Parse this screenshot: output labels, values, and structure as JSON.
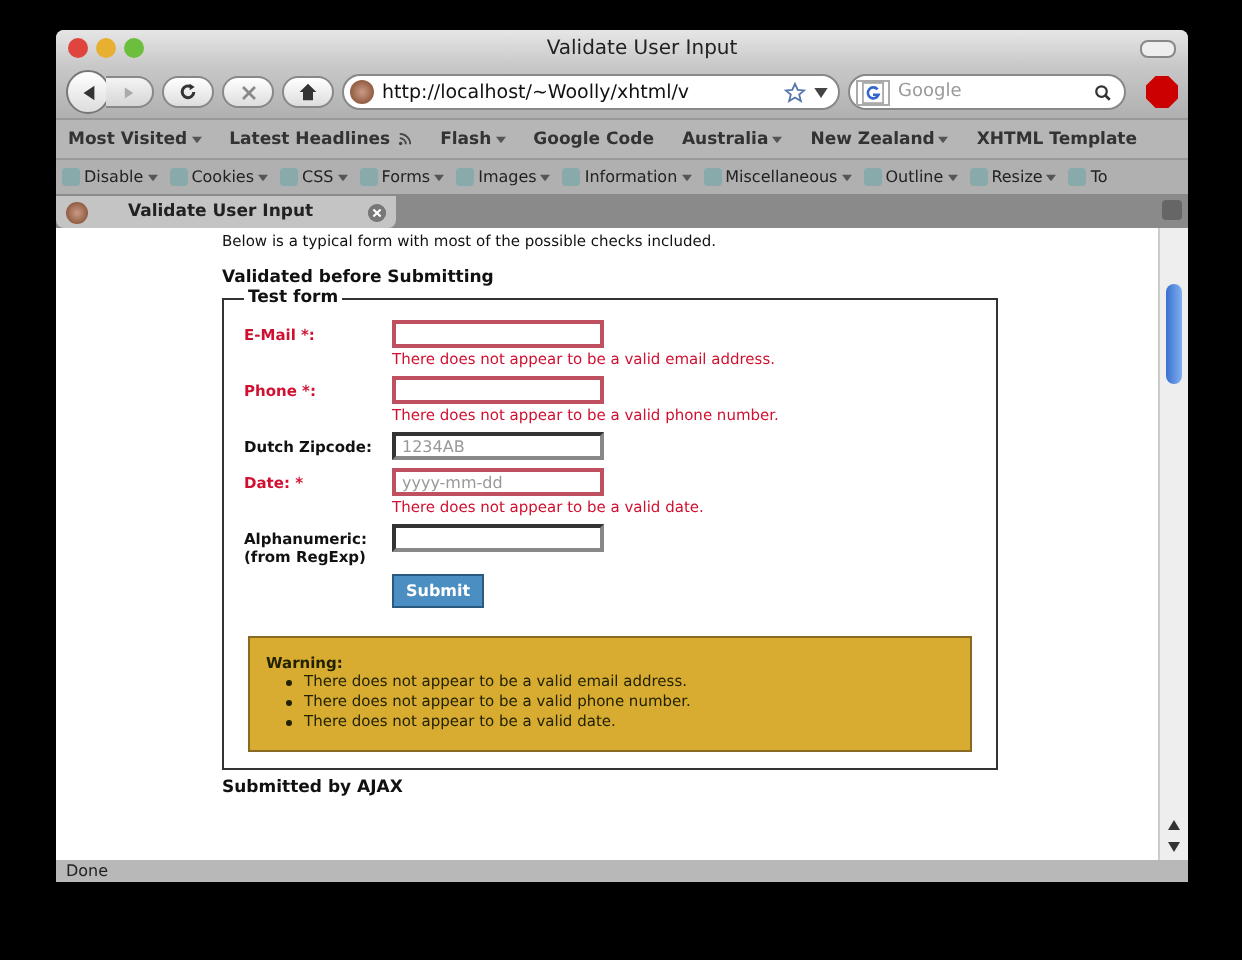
{
  "window": {
    "title": "Validate User Input"
  },
  "nav": {
    "url": "http://localhost/~Woolly/xhtml/v",
    "search_placeholder": "Google"
  },
  "bookmarks": [
    {
      "label": "Most Visited",
      "kind": "menu"
    },
    {
      "label": "Latest Headlines",
      "kind": "feed"
    },
    {
      "label": "Flash",
      "kind": "menu"
    },
    {
      "label": "Google Code",
      "kind": "link"
    },
    {
      "label": "Australia",
      "kind": "menu"
    },
    {
      "label": "New Zealand",
      "kind": "menu"
    },
    {
      "label": "XHTML Template",
      "kind": "link"
    }
  ],
  "dev_toolbar": [
    {
      "label": "Disable",
      "kind": "menu"
    },
    {
      "label": "Cookies",
      "kind": "menu"
    },
    {
      "label": "CSS",
      "kind": "menu"
    },
    {
      "label": "Forms",
      "kind": "menu"
    },
    {
      "label": "Images",
      "kind": "menu"
    },
    {
      "label": "Information",
      "kind": "menu"
    },
    {
      "label": "Miscellaneous",
      "kind": "menu"
    },
    {
      "label": "Outline",
      "kind": "menu"
    },
    {
      "label": "Resize",
      "kind": "menu"
    },
    {
      "label": "To",
      "kind": "link"
    }
  ],
  "tabs": [
    {
      "label": "Validate User Input",
      "selected": true
    }
  ],
  "page": {
    "intro": "Below is a typical form with most of the possible checks included.",
    "heading": "Validated before Submitting",
    "legend": "Test form",
    "fields": [
      {
        "label": "E-Mail *:",
        "invalid": true,
        "error": "There does not appear to be a valid email address."
      },
      {
        "label": "Phone *:",
        "invalid": true,
        "error": "There does not appear to be a valid phone number."
      },
      {
        "label": "Dutch Zipcode:",
        "invalid": false,
        "placeholder": "1234AB"
      },
      {
        "label": "Date: *",
        "invalid": true,
        "placeholder": "yyyy-mm-dd",
        "error": "There does not appear to be a valid date."
      },
      {
        "label": "Alphanumeric: (from RegExp)",
        "invalid": false
      }
    ],
    "submit": "Submit",
    "warning": {
      "title": "Warning:",
      "items": [
        "There does not appear to be a valid email address.",
        "There does not appear to be a valid phone number.",
        "There does not appear to be a valid date."
      ]
    },
    "next_heading": "Submitted by AJAX"
  },
  "status_bar": {
    "text": "Done"
  }
}
